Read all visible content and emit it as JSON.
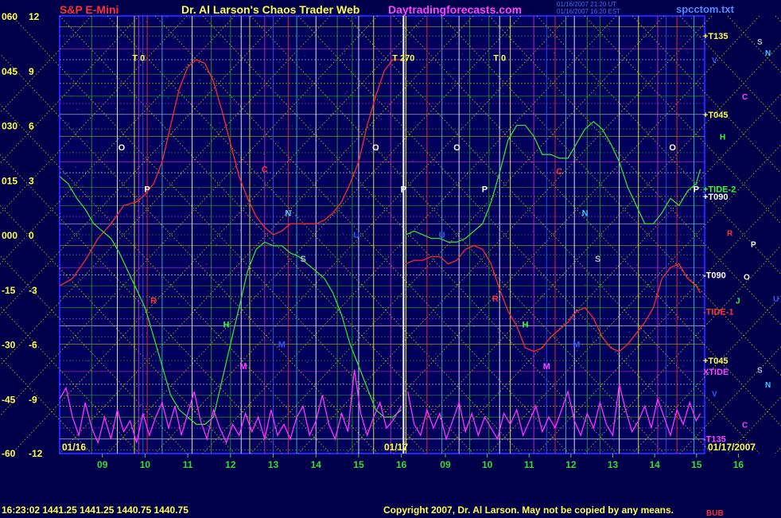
{
  "header": {
    "instrument": "S&P E-Mini",
    "title": "Dr. Al Larson's Chaos Trader Web",
    "website": "Daytradingforecasts.com",
    "timestamp_line1": "01/16/2007 21:20 UT",
    "timestamp_line2": "01/16/2007 16:20 EST",
    "filename": "spcctom.txt"
  },
  "footer": {
    "quote": "16:23:02  1441.25  1441.25  1440.75  1440.75",
    "copyright": "Copyright 2007, Dr. Al Larson. May not be copied by any means.",
    "tag": "BUB"
  },
  "colors": {
    "background": "#00004a",
    "plot_background": "#00005c",
    "frame": "#2222ff",
    "red_line": "#ff2a2a",
    "green_line": "#33dd33",
    "magenta_line": "#ff33ff",
    "yellow_dotted": "#e6e600",
    "header_red": "#ff3030",
    "header_yellow": "#ffff44",
    "header_magenta": "#ff44ff",
    "date_yellow": "#ffff44"
  },
  "chart_data": {
    "type": "line",
    "x_tick_labels": [
      "09",
      "10",
      "11",
      "12",
      "13",
      "14",
      "15",
      "16",
      "09",
      "10",
      "11",
      "12",
      "13",
      "14",
      "15",
      "16"
    ],
    "date_labels": [
      "01/16",
      "01/17",
      "01/17/2007"
    ],
    "y_left_outer_labels": [
      "060",
      "045",
      "030",
      "015",
      "000",
      "-15",
      "-30",
      "-45",
      "-60"
    ],
    "y_left_inner_labels": [
      "12",
      "9",
      "6",
      "3",
      "0",
      "-3",
      "-6",
      "-9",
      "-12"
    ],
    "ylim_outer": [
      -60,
      60
    ],
    "right_level_labels": [
      {
        "label": "+T135",
        "value": 54.5,
        "color": "#ffff44"
      },
      {
        "label": "+T045",
        "value": 33,
        "color": "#ffff44"
      },
      {
        "label": "+T090",
        "value": 10.5,
        "color": "#ffffff"
      },
      {
        "label": "+TIDE-2",
        "value": 12.5,
        "color": "#33ff33"
      },
      {
        "label": "-T090",
        "value": -11,
        "color": "#ffffff"
      },
      {
        "label": "-TIDE-1",
        "value": -21,
        "color": "#ff3333"
      },
      {
        "label": "+T045",
        "value": -34.5,
        "color": "#ffff44"
      },
      {
        "label": "XTIDE",
        "value": -37.5,
        "color": "#ff44ff"
      },
      {
        "label": "-T135",
        "value": -56,
        "color": "#ff44ff"
      }
    ],
    "right_planet_letters": [
      {
        "label": "S",
        "value": 53,
        "color": "#bbbbbb"
      },
      {
        "label": "N",
        "value": 50,
        "color": "#33ccff"
      },
      {
        "label": "V",
        "value": 48,
        "color": "#3355ff"
      },
      {
        "label": "C",
        "value": 38,
        "color": "#ff44ff"
      },
      {
        "label": "H",
        "value": 27,
        "color": "#33ff33"
      },
      {
        "label": "R",
        "value": 0.5,
        "color": "#ff3333"
      },
      {
        "label": "P",
        "value": -2.5,
        "color": "#ffffff"
      },
      {
        "label": "O",
        "value": -11.5,
        "color": "#ffffff"
      },
      {
        "label": "J",
        "value": -18,
        "color": "#33ff33"
      },
      {
        "label": "U",
        "value": -17.5,
        "color": "#3355ff"
      },
      {
        "label": "S",
        "value": -37,
        "color": "#bbbbbb"
      },
      {
        "label": "N",
        "value": -41,
        "color": "#33ccff"
      },
      {
        "label": "V",
        "value": -43.5,
        "color": "#3355ff"
      },
      {
        "label": "C",
        "value": -52,
        "color": "#ff44ff"
      }
    ],
    "chart_annotations": [
      {
        "label": "T 0",
        "x": 9.85,
        "value": 48.5,
        "color": "#ffff44"
      },
      {
        "label": "T 270",
        "x": 16.05,
        "value": 48.5,
        "color": "#ffff44"
      },
      {
        "label": "T 0",
        "x": 18.3,
        "value": 48.5,
        "color": "#ffff44"
      },
      {
        "label": "O",
        "x": 9.45,
        "value": 24,
        "color": "#ffffff"
      },
      {
        "label": "O",
        "x": 15.4,
        "value": 24,
        "color": "#ffffff"
      },
      {
        "label": "O",
        "x": 17.3,
        "value": 24,
        "color": "#ffffff"
      },
      {
        "label": "O",
        "x": 22.35,
        "value": 24,
        "color": "#ffffff"
      },
      {
        "label": "P",
        "x": 10.05,
        "value": 12.5,
        "color": "#ffffff"
      },
      {
        "label": "P",
        "x": 16.05,
        "value": 12.5,
        "color": "#ffffff"
      },
      {
        "label": "P",
        "x": 17.95,
        "value": 12.5,
        "color": "#ffffff"
      },
      {
        "label": "P",
        "x": 22.9,
        "value": 12.5,
        "color": "#ffffff"
      },
      {
        "label": "C",
        "x": 12.8,
        "value": 18,
        "color": "#ff3333"
      },
      {
        "label": "C",
        "x": 19.7,
        "value": 17.5,
        "color": "#ff3333"
      },
      {
        "label": "N",
        "x": 13.35,
        "value": 6,
        "color": "#33ccff"
      },
      {
        "label": "N",
        "x": 20.3,
        "value": 6,
        "color": "#33ccff"
      },
      {
        "label": "S",
        "x": 13.7,
        "value": -6.5,
        "color": "#bbbbbb"
      },
      {
        "label": "S",
        "x": 20.6,
        "value": -6.5,
        "color": "#bbbbbb"
      },
      {
        "label": "U",
        "x": 14.95,
        "value": 0,
        "color": "#3355ff"
      },
      {
        "label": "U",
        "x": 16.95,
        "value": 0,
        "color": "#3355ff"
      },
      {
        "label": "R",
        "x": 10.2,
        "value": -18,
        "color": "#ff3333"
      },
      {
        "label": "R",
        "x": 18.2,
        "value": -17.5,
        "color": "#ff3333"
      },
      {
        "label": "H",
        "x": 11.9,
        "value": -24.5,
        "color": "#33ff33"
      },
      {
        "label": "H",
        "x": 18.9,
        "value": -24.5,
        "color": "#33ff33"
      },
      {
        "label": "M",
        "x": 13.2,
        "value": -30,
        "color": "#3355ff"
      },
      {
        "label": "M",
        "x": 20.1,
        "value": -30,
        "color": "#3355ff"
      },
      {
        "label": "M",
        "x": 12.3,
        "value": -36,
        "color": "#ff44ff"
      },
      {
        "label": "M",
        "x": 19.4,
        "value": -36,
        "color": "#ff44ff"
      }
    ],
    "series": [
      {
        "name": "",
        "color": "#ff2a2a",
        "x": [
          8.0,
          8.3,
          8.6,
          8.9,
          9.2,
          9.5,
          9.8,
          10.0,
          10.2,
          10.4,
          10.6,
          10.8,
          11.0,
          11.2,
          11.4,
          11.6,
          11.8,
          12.0,
          12.2,
          12.4,
          12.6,
          12.8,
          13.0,
          13.2,
          13.4,
          13.6,
          13.8,
          14.0,
          14.2,
          14.4,
          14.6,
          14.8,
          15.0,
          15.2,
          15.4,
          15.6,
          15.8,
          16.0,
          16.1,
          16.3,
          16.5,
          16.7,
          16.9,
          17.1,
          17.3,
          17.5,
          17.7,
          17.9,
          18.1,
          18.3,
          18.5,
          18.7,
          18.9,
          19.1,
          19.3,
          19.5,
          19.7,
          19.9,
          20.1,
          20.3,
          20.5,
          20.7,
          20.9,
          21.1,
          21.3,
          21.5,
          21.7,
          21.9,
          22.1,
          22.3,
          22.5,
          22.7,
          22.9,
          23.0
        ],
        "y": [
          -14,
          -12,
          -7,
          -1,
          3,
          8,
          9,
          11,
          14,
          20,
          30,
          40,
          46,
          48,
          47,
          42,
          34,
          25,
          16,
          10,
          5,
          2,
          0,
          1,
          3,
          3,
          3,
          3,
          4,
          6,
          9,
          14,
          20,
          30,
          38,
          45,
          48,
          48,
          -8,
          -7,
          -7,
          -6,
          -6,
          -8,
          -7,
          -4,
          -3,
          -4,
          -8,
          -15,
          -21,
          -25,
          -31,
          -32,
          -31,
          -28,
          -26,
          -24,
          -21,
          -20,
          -23,
          -28,
          -31,
          -32,
          -30,
          -27,
          -24,
          -20,
          -12,
          -9,
          -8,
          -12,
          -14,
          -16
        ]
      },
      {
        "name": "",
        "color": "#33dd33",
        "x": [
          8.0,
          8.2,
          8.4,
          8.6,
          8.8,
          9.0,
          9.2,
          9.4,
          9.6,
          9.8,
          10.0,
          10.2,
          10.4,
          10.6,
          10.8,
          11.0,
          11.2,
          11.4,
          11.6,
          11.8,
          12.0,
          12.2,
          12.4,
          12.6,
          12.8,
          13.0,
          13.2,
          13.4,
          13.6,
          13.8,
          14.0,
          14.2,
          14.4,
          14.6,
          14.8,
          15.0,
          15.2,
          15.4,
          15.6,
          15.8,
          16.0,
          16.1,
          16.3,
          16.5,
          16.7,
          16.9,
          17.1,
          17.3,
          17.5,
          17.7,
          17.9,
          18.1,
          18.3,
          18.5,
          18.7,
          18.9,
          19.1,
          19.3,
          19.5,
          19.7,
          19.9,
          20.1,
          20.3,
          20.5,
          20.7,
          20.9,
          21.1,
          21.3,
          21.5,
          21.7,
          21.9,
          22.1,
          22.3,
          22.5,
          22.7,
          22.9,
          23.0
        ],
        "y": [
          16,
          14,
          10,
          7,
          3,
          1,
          -1,
          -5,
          -10,
          -15,
          -20,
          -28,
          -36,
          -44,
          -48,
          -50,
          -52,
          -52,
          -50,
          -40,
          -30,
          -20,
          -10,
          -4,
          -2,
          -3,
          -3,
          -5,
          -6,
          -8,
          -10,
          -12,
          -16,
          -22,
          -30,
          -36,
          -42,
          -48,
          -50,
          -50,
          -48,
          0,
          1,
          0,
          -1,
          -1,
          -2,
          -2,
          -1,
          1,
          3,
          9,
          17,
          26,
          30,
          30,
          27,
          22,
          22,
          21,
          21,
          25,
          29,
          31,
          29,
          25,
          20,
          13,
          8,
          3,
          3,
          6,
          10,
          8,
          12,
          14,
          18
        ]
      },
      {
        "name": "",
        "color": "#ff33ff",
        "x": [
          8.0,
          8.15,
          8.3,
          8.45,
          8.6,
          8.75,
          8.9,
          9.05,
          9.2,
          9.35,
          9.5,
          9.65,
          9.8,
          9.95,
          10.1,
          10.25,
          10.4,
          10.55,
          10.7,
          10.85,
          11.0,
          11.15,
          11.3,
          11.45,
          11.6,
          11.75,
          11.9,
          12.05,
          12.2,
          12.35,
          12.5,
          12.65,
          12.8,
          12.95,
          13.1,
          13.25,
          13.4,
          13.55,
          13.7,
          13.85,
          14.0,
          14.15,
          14.3,
          14.45,
          14.6,
          14.75,
          14.9,
          15.05,
          15.2,
          15.35,
          15.5,
          15.65,
          15.8,
          16.0,
          16.15,
          16.3,
          16.45,
          16.6,
          16.75,
          16.9,
          17.05,
          17.2,
          17.35,
          17.5,
          17.65,
          17.8,
          17.95,
          18.1,
          18.25,
          18.4,
          18.55,
          18.7,
          18.85,
          19.0,
          19.15,
          19.3,
          19.45,
          19.6,
          19.75,
          19.9,
          20.05,
          20.2,
          20.35,
          20.5,
          20.65,
          20.8,
          20.95,
          21.1,
          21.25,
          21.4,
          21.55,
          21.7,
          21.85,
          22.0,
          22.15,
          22.3,
          22.45,
          22.6,
          22.75,
          22.9,
          23.0
        ],
        "y": [
          -45,
          -42,
          -50,
          -55,
          -46,
          -53,
          -57,
          -50,
          -56,
          -48,
          -54,
          -51,
          -57,
          -49,
          -55,
          -50,
          -46,
          -53,
          -47,
          -55,
          -49,
          -43,
          -51,
          -56,
          -48,
          -53,
          -57,
          -52,
          -55,
          -49,
          -54,
          -50,
          -56,
          -48,
          -55,
          -52,
          -56,
          -50,
          -47,
          -55,
          -51,
          -44,
          -52,
          -56,
          -49,
          -54,
          -37,
          -49,
          -55,
          -50,
          -46,
          -53,
          -51,
          -47,
          -43,
          -52,
          -55,
          -48,
          -53,
          -49,
          -56,
          -51,
          -46,
          -54,
          -49,
          -55,
          -50,
          -53,
          -56,
          -49,
          -52,
          -48,
          -55,
          -51,
          -47,
          -54,
          -50,
          -53,
          -48,
          -43,
          -51,
          -55,
          -49,
          -53,
          -46,
          -52,
          -55,
          -41,
          -48,
          -54,
          -51,
          -47,
          -53,
          -45,
          -50,
          -55,
          -48,
          -52,
          -46,
          -51,
          -49
        ]
      }
    ],
    "xlim": [
      8,
      23.1
    ],
    "vertical_marker_x": [
      8.75,
      9.35,
      9.75,
      9.85,
      9.95,
      10.05,
      10.4,
      11.1,
      11.55,
      12.0,
      12.25,
      12.45,
      12.8,
      13.0,
      13.35,
      13.55,
      14.0,
      14.5,
      14.85,
      15.0,
      15.35,
      15.75,
      16.05,
      16.6,
      16.95,
      17.35,
      17.6,
      18.05,
      18.3,
      18.55,
      19.1,
      19.4,
      19.6,
      19.85,
      20.05,
      20.35,
      20.65,
      21.1,
      21.55,
      22.0,
      22.2,
      22.45,
      22.85
    ],
    "horizontal_level_values": [
      57,
      54.5,
      51,
      48,
      44,
      41.5,
      38,
      36,
      33,
      29,
      27,
      22.5,
      20,
      17,
      13,
      10.5,
      8,
      5,
      3,
      0,
      -3,
      -5.5,
      -9,
      -11,
      -14,
      -17,
      -20,
      -23,
      -25,
      -28,
      -30,
      -34.5,
      -37.5,
      -41,
      -44,
      -47,
      -50,
      -53,
      -56,
      -59
    ],
    "diagonal_grid": true
  }
}
